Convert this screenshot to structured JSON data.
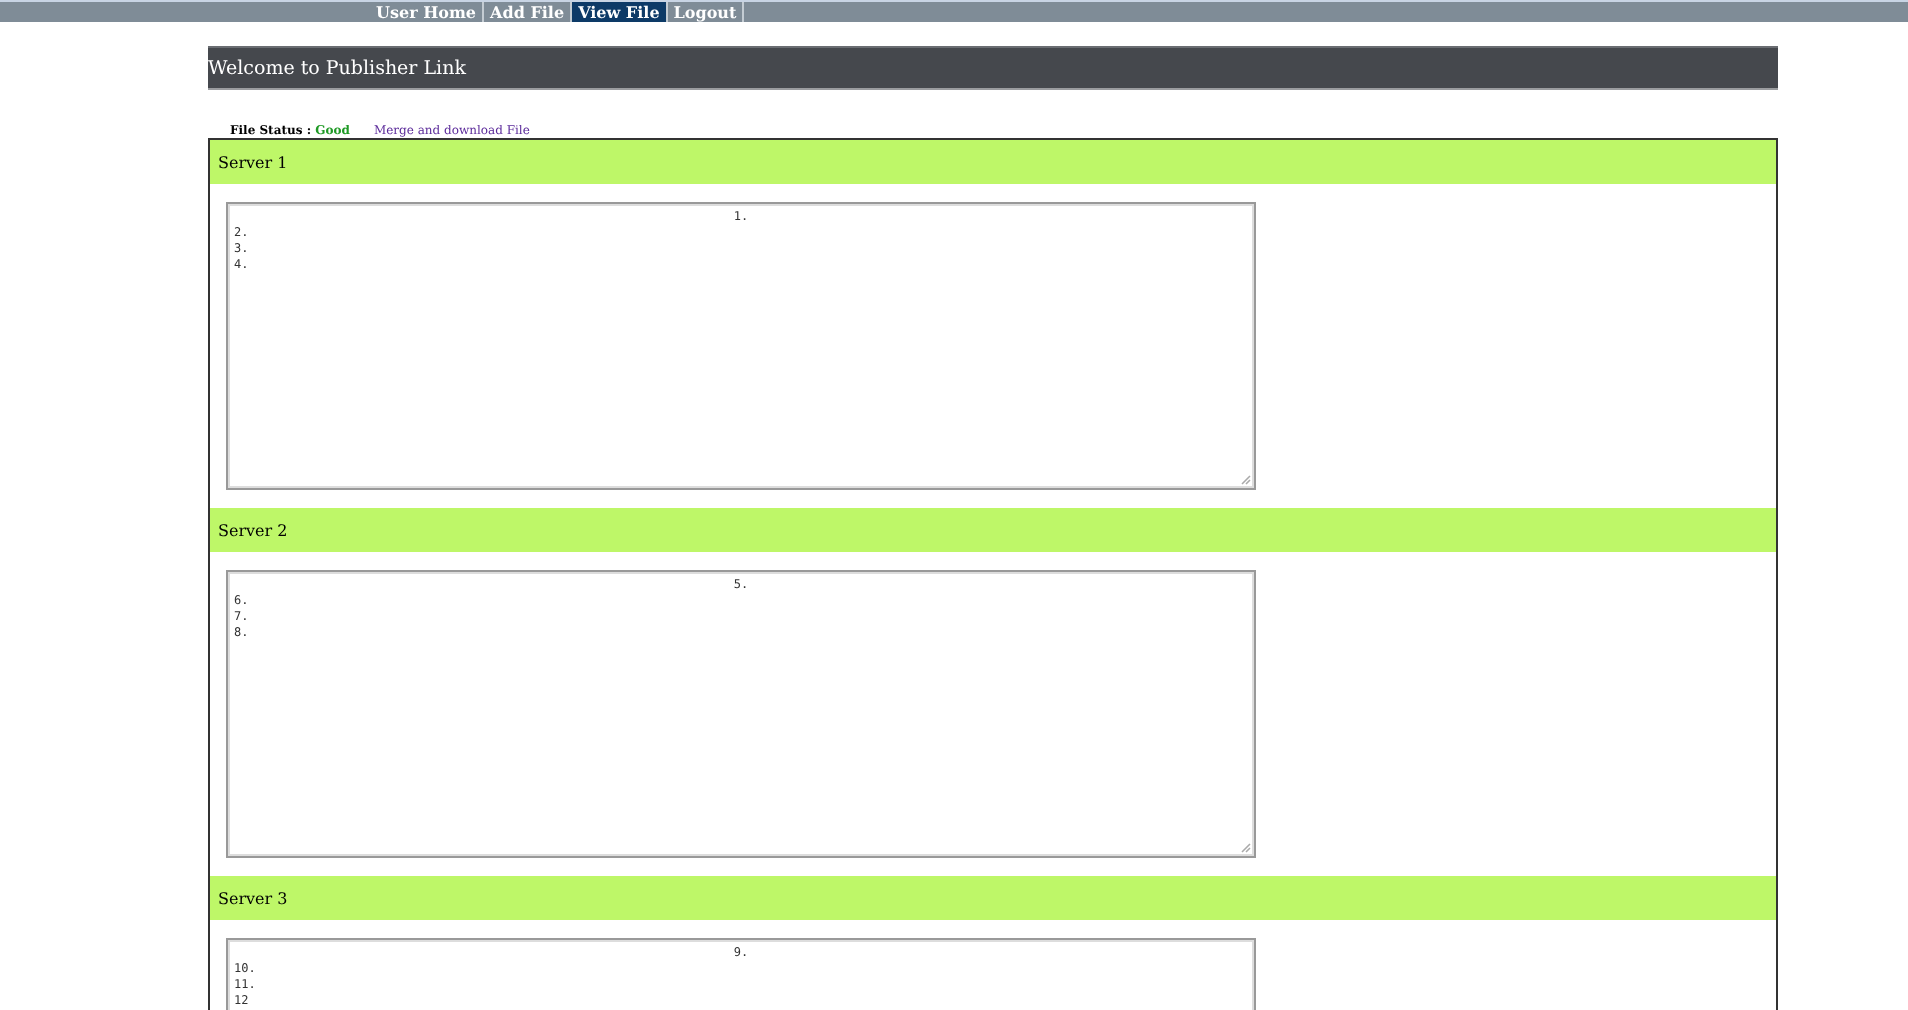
{
  "nav": {
    "items": [
      {
        "label": "User Home",
        "selected": false
      },
      {
        "label": "Add File",
        "selected": false
      },
      {
        "label": "View File",
        "selected": true
      },
      {
        "label": "Logout",
        "selected": false
      }
    ]
  },
  "header": {
    "title": "Welcome to Publisher Link"
  },
  "status": {
    "label": "File Status :",
    "value": "Good",
    "link": "Merge and download File"
  },
  "servers": [
    {
      "title": "Server 1",
      "lines": [
        "1.",
        "2.",
        "3.",
        "4."
      ]
    },
    {
      "title": "Server 2",
      "lines": [
        "5.",
        "6.",
        "7.",
        "8."
      ]
    },
    {
      "title": "Server 3",
      "lines": [
        "9.",
        "10.",
        "11.",
        "12"
      ]
    }
  ]
}
